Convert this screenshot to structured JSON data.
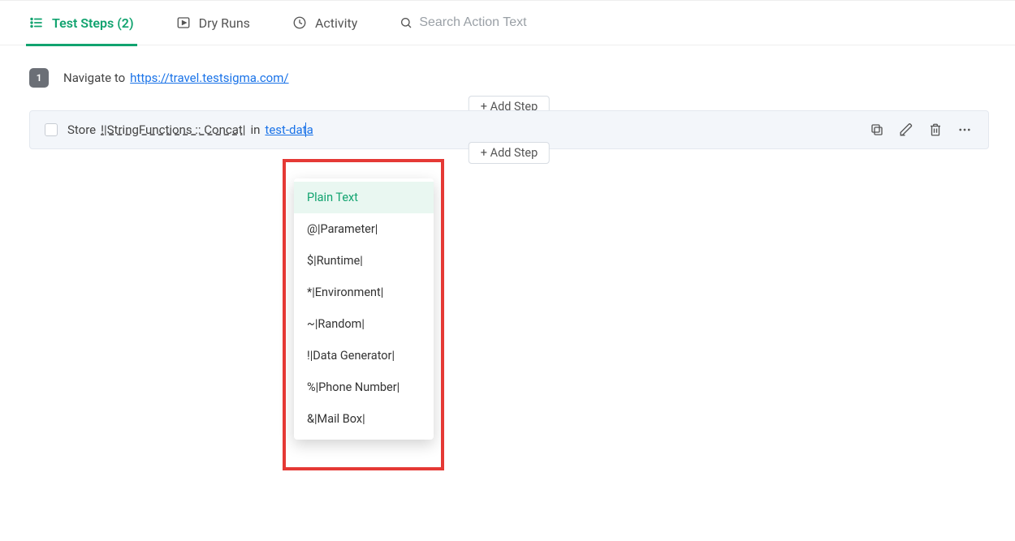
{
  "tabs": {
    "test_steps": "Test Steps (2)",
    "dry_runs": "Dry Runs",
    "activity": "Activity"
  },
  "search": {
    "placeholder": "Search Action Text"
  },
  "step1": {
    "number": "1",
    "prefix": "Navigate to",
    "url": "https://travel.testsigma.com/"
  },
  "step2": {
    "prefix": "Store",
    "function": "!|StringFunctions :: Concat|",
    "in": "in",
    "data": "test-data",
    "add_step": "+ Add Step"
  },
  "dropdown": {
    "items": [
      "Plain Text",
      "@|Parameter|",
      "$|Runtime|",
      "*|Environment|",
      "~|Random|",
      "!|Data Generator|",
      "%|Phone Number|",
      "&|Mail Box|"
    ]
  }
}
